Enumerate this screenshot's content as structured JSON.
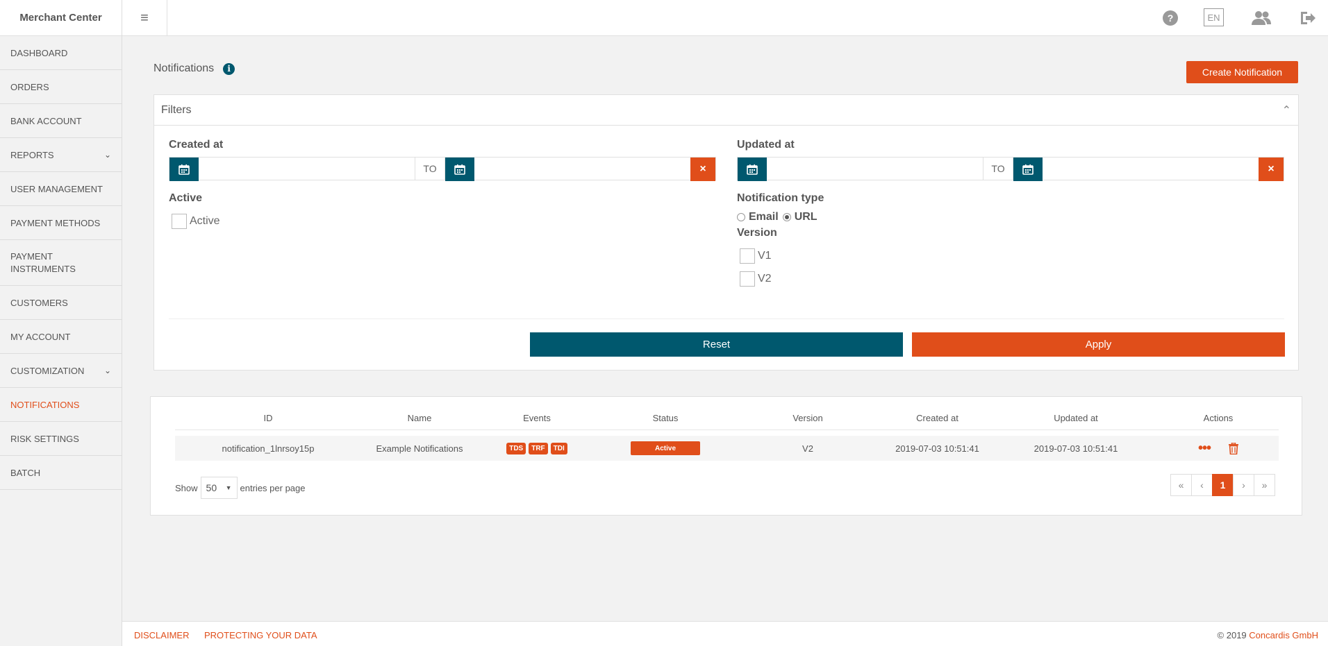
{
  "app": {
    "title": "Merchant Center"
  },
  "sidebar": {
    "items": [
      {
        "label": "DASHBOARD"
      },
      {
        "label": "ORDERS"
      },
      {
        "label": "BANK ACCOUNT"
      },
      {
        "label": "REPORTS"
      },
      {
        "label": "USER MANAGEMENT"
      },
      {
        "label": "PAYMENT METHODS"
      },
      {
        "label": "PAYMENT INSTRUMENTS"
      },
      {
        "label": "CUSTOMERS"
      },
      {
        "label": "MY ACCOUNT"
      },
      {
        "label": "CUSTOMIZATION"
      },
      {
        "label": "NOTIFICATIONS"
      },
      {
        "label": "RISK SETTINGS"
      },
      {
        "label": "BATCH"
      }
    ]
  },
  "header": {
    "lang": "EN"
  },
  "page": {
    "title": "Notifications",
    "create_label": "Create Notification"
  },
  "filters": {
    "title": "Filters",
    "created_at": "Created at",
    "updated_at": "Updated at",
    "to": "TO",
    "active_heading": "Active",
    "active_option": "Active",
    "notification_type": "Notification type",
    "email": "Email",
    "url": "URL",
    "version": "Version",
    "v1": "V1",
    "v2": "V2",
    "reset": "Reset",
    "apply": "Apply"
  },
  "table": {
    "headers": [
      "ID",
      "Name",
      "Events",
      "Status",
      "Version",
      "Created at",
      "Updated at",
      "Actions"
    ],
    "rows": [
      {
        "id": "notification_1lnrsoy15p",
        "name": "Example Notifications",
        "events": [
          "TDS",
          "TRF",
          "TDI"
        ],
        "status": "Active",
        "version": "V2",
        "created": "2019-07-03 10:51:41",
        "updated": "2019-07-03 10:51:41"
      }
    ],
    "show_label": "Show",
    "per_page": "50",
    "entries_label": "entries per page",
    "pager": {
      "first": "«",
      "prev": "‹",
      "current": "1",
      "next": "›",
      "last": "»"
    }
  },
  "footer": {
    "disclaimer": "DISCLAIMER",
    "protect": "PROTECTING YOUR DATA",
    "copyright": "© 2019",
    "company": "Concardis GmbH"
  },
  "colors": {
    "accent": "#e04e1a",
    "primary": "#00586e"
  },
  "icons": [
    "hamburger-icon",
    "help-icon",
    "users-icon",
    "logout-icon",
    "info-icon",
    "calendar-icon",
    "close-icon",
    "chevron-up-icon",
    "chevron-down-icon",
    "dots-icon",
    "trash-icon"
  ]
}
